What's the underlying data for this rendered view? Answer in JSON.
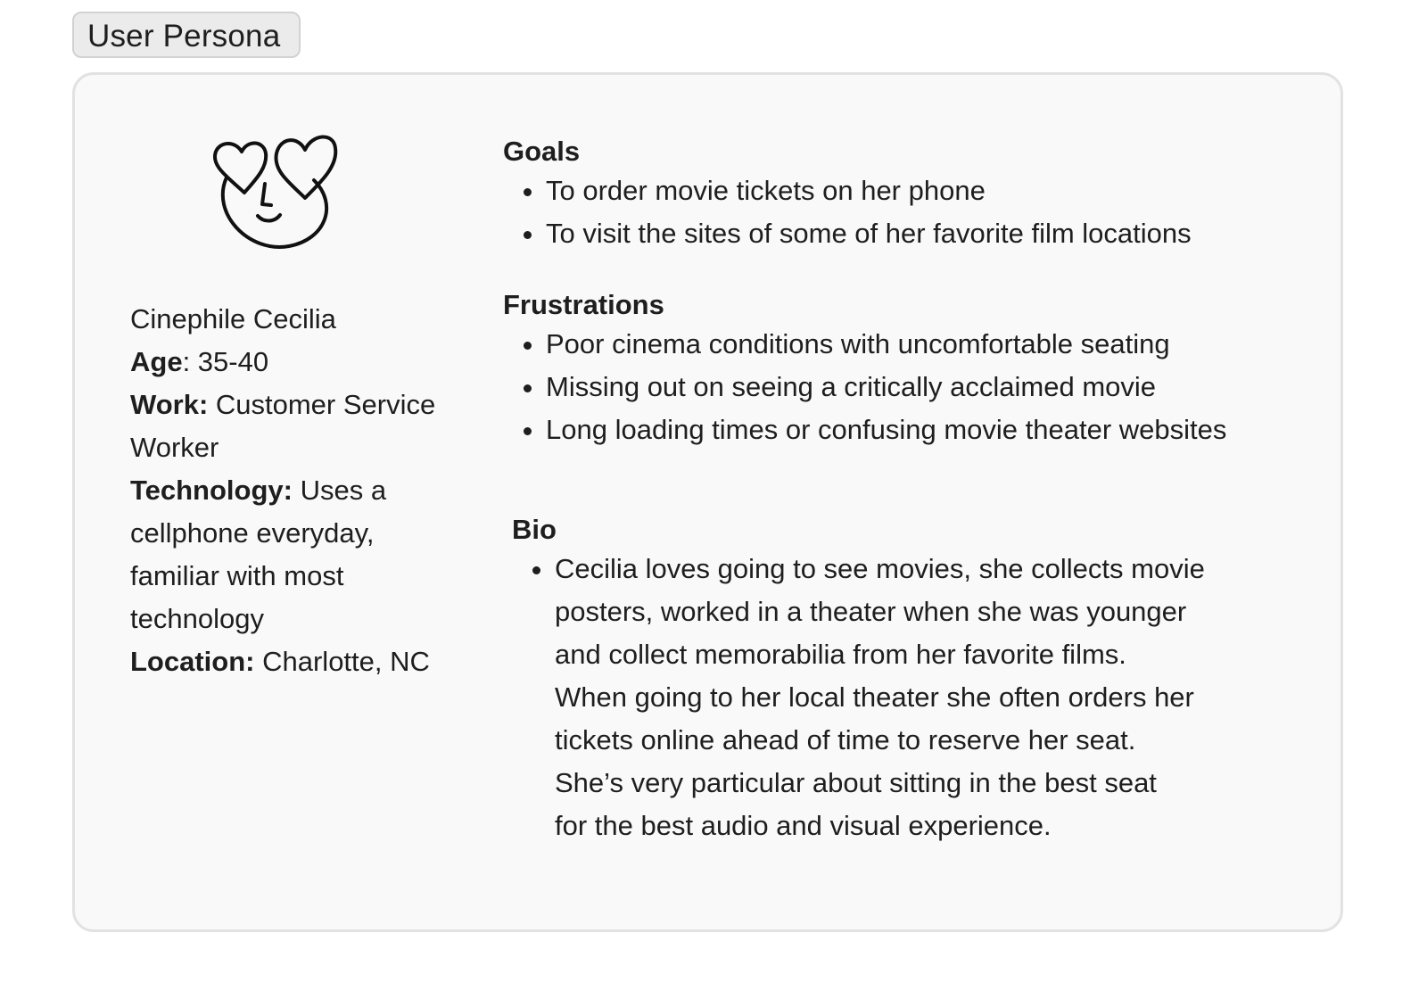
{
  "header": {
    "label": "User Persona"
  },
  "persona": {
    "avatar_icon": "heart-eyes-face-icon",
    "name": "Cinephile Cecilia",
    "age_label": "Age",
    "age_value": ": 35-40",
    "work_label": "Work:",
    "work_value": " Customer Service Worker",
    "technology_label": "Technology:",
    "technology_value": " Uses a cellphone everyday, familiar with most technology",
    "location_label": "Location:",
    "location_value": " Charlotte, NC"
  },
  "goals": {
    "title": "Goals",
    "items": [
      "To order movie tickets on her phone",
      "To visit the sites of some of her favorite film locations"
    ]
  },
  "frustrations": {
    "title": "Frustrations",
    "items": [
      "Poor cinema conditions with uncomfortable seating",
      "Missing out on seeing a critically acclaimed movie",
      "Long loading times or confusing movie theater websites"
    ]
  },
  "bio": {
    "title": "Bio",
    "lines": [
      "Cecilia loves going to see movies, she collects movie",
      "posters, worked in a theater when she was younger",
      "and collect memorabilia from her favorite films.",
      "When going to her local theater she often orders her",
      "tickets online ahead of time to reserve her seat.",
      "She’s very particular about sitting in the best seat",
      "for the best audio and visual experience."
    ]
  }
}
